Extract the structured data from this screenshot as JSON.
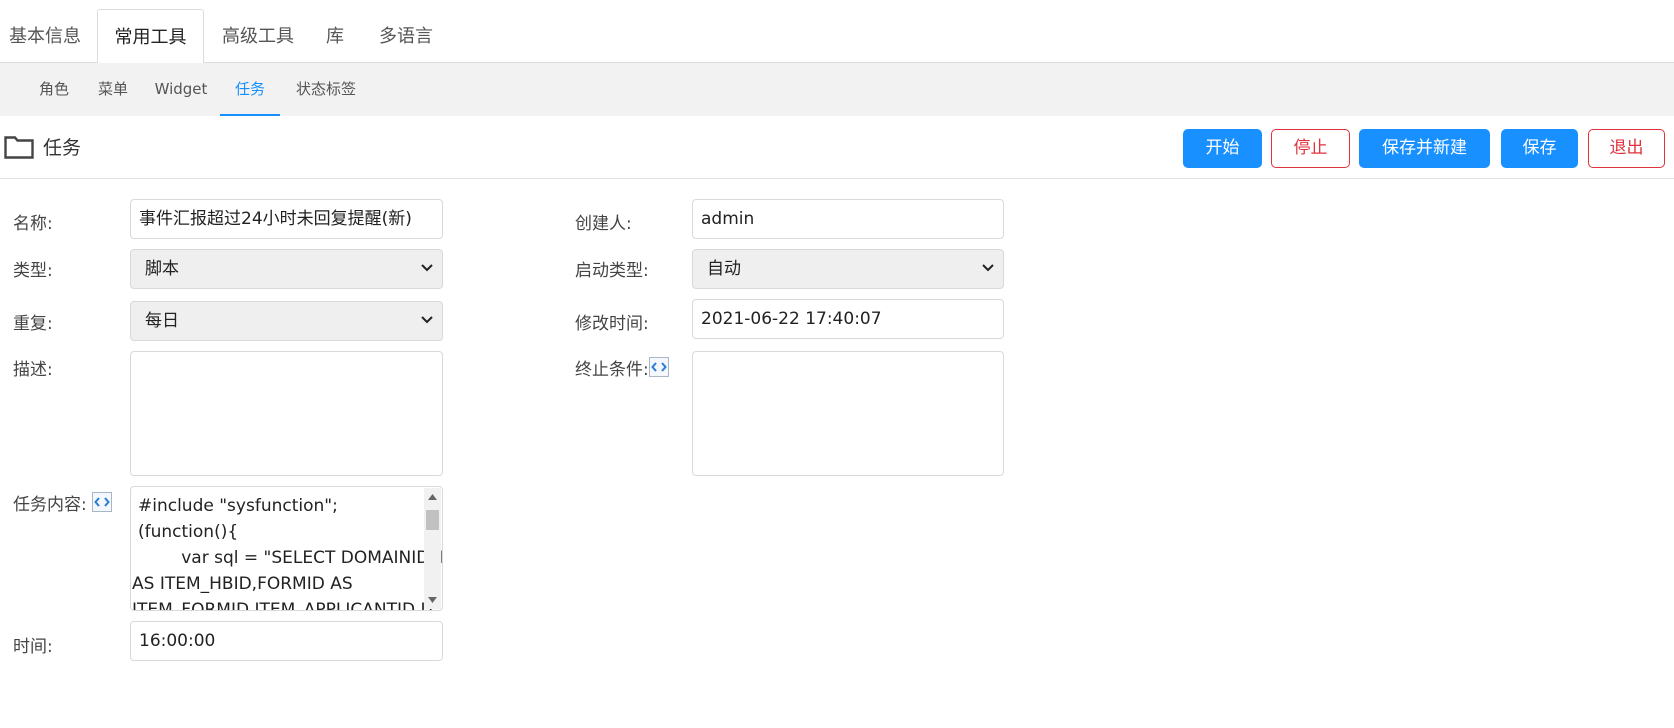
{
  "top_tabs": [
    "基本信息",
    "常用工具",
    "高级工具",
    "库",
    "多语言"
  ],
  "sub_tabs": [
    "角色",
    "菜单",
    "Widget",
    "任务",
    "状态标签"
  ],
  "toolbar": {
    "title": "任务",
    "start": "开始",
    "stop": "停止",
    "save_new": "保存并新建",
    "save": "保存",
    "exit": "退出"
  },
  "form": {
    "name_label": "名称:",
    "name_value": "事件汇报超过24小时未回复提醒(新)",
    "creator_label": "创建人:",
    "creator_value": "admin",
    "type_label": "类型:",
    "type_value": "脚本",
    "start_type_label": "启动类型:",
    "start_type_value": "自动",
    "repeat_label": "重复:",
    "repeat_value": "每日",
    "modified_label": "修改时间:",
    "modified_value": "2021-06-22 17:40:07",
    "desc_label": "描述:",
    "stop_cond_label": "终止条件:",
    "content_label": "任务内容:",
    "content_lines": [
      "#include \"sysfunction\";",
      "(function(){",
      "        var sql = \"SELECT DOMAINID,ID",
      "AS ITEM_HBID,FORMID AS",
      "ITEM_FORMID,ITEM_APPLICANTID,IT"
    ],
    "time_label": "时间:",
    "time_value": "16:00:00"
  },
  "colors": {
    "primary": "#1890ff",
    "danger": "#e0313c"
  }
}
